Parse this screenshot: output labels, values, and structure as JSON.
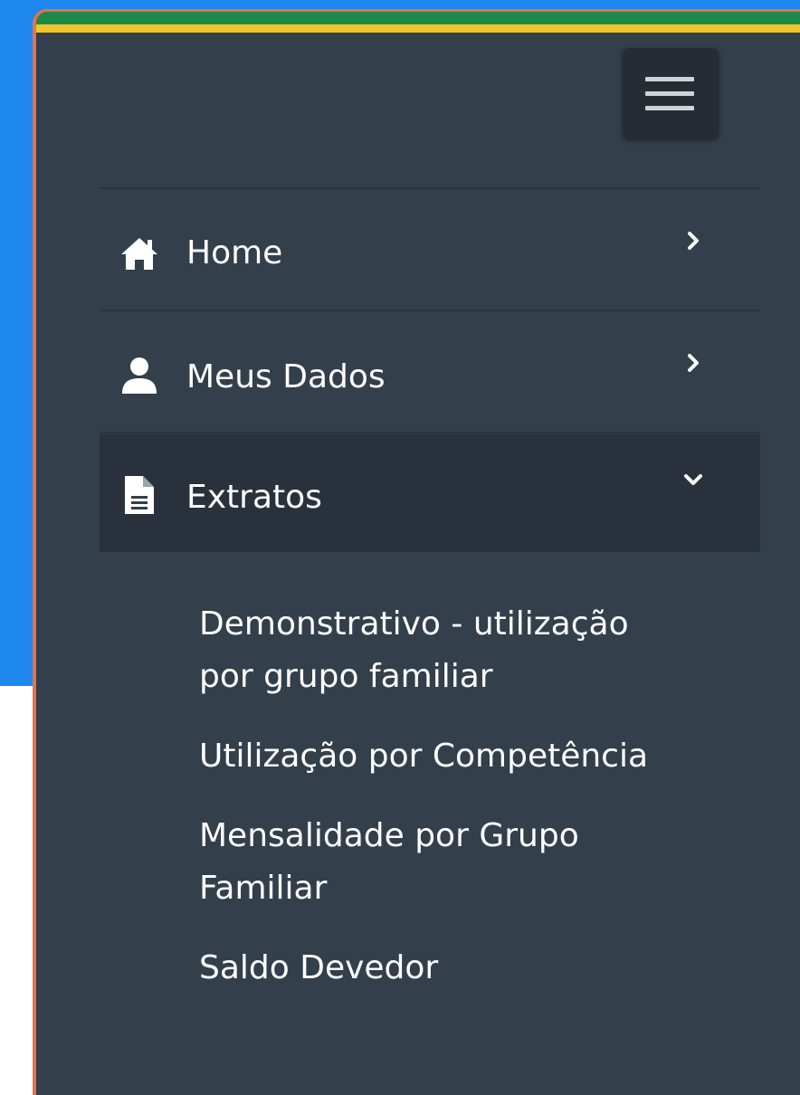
{
  "colors": {
    "background_accent": "#1e88f0",
    "panel": "#333f4a",
    "active_item": "#29323c",
    "stripe_green": "#1d8a4a",
    "stripe_yellow": "#f2c62a",
    "panel_border": "#e8714a"
  },
  "menu": {
    "items": [
      {
        "label": "Home",
        "icon": "home-icon",
        "state": "collapsed"
      },
      {
        "label": "Meus Dados",
        "icon": "user-icon",
        "state": "collapsed"
      },
      {
        "label": "Extratos",
        "icon": "document-icon",
        "state": "expanded"
      }
    ],
    "subitems": [
      {
        "line1": "Demonstrativo - utilização",
        "line2": "por grupo familiar"
      },
      {
        "line1": "Utilização por Competência",
        "line2": ""
      },
      {
        "line1": "Mensalidade por Grupo",
        "line2": "Familiar"
      },
      {
        "line1": "Saldo Devedor",
        "line2": ""
      }
    ]
  },
  "toggle_icon": "hamburger-menu-icon"
}
